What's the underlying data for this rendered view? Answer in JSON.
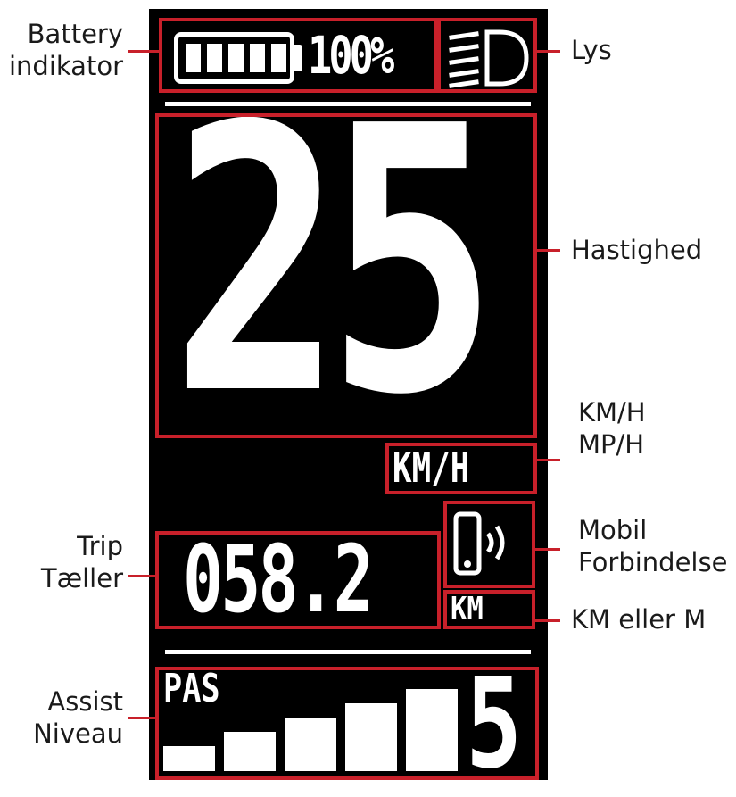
{
  "display": {
    "battery_percent": "100%",
    "battery_level": 1.0,
    "speed": "25",
    "speed_unit": "KM/H",
    "trip": "058.2",
    "trip_unit": "KM",
    "pas_label": "PAS",
    "assist_level": "5",
    "assist_level_value": 5,
    "assist_level_max": 5
  },
  "labels": {
    "battery_line1": "Battery",
    "battery_line2": "indikator",
    "lys": "Lys",
    "hastighed": "Hastighed",
    "unit_line1": "KM/H",
    "unit_line2": "MP/H",
    "mobil_line1": "Mobil",
    "mobil_line2": "Forbindelse",
    "km_eller_m": "KM eller M",
    "trip_line1": "Trip",
    "trip_line2": "Tæller",
    "assist_line1": "Assist",
    "assist_line2": "Niveau"
  },
  "colors": {
    "highlight": "#c8202a",
    "display_bg": "#000000",
    "display_fg": "#ffffff"
  },
  "icons": [
    "battery-icon",
    "headlight-icon",
    "phone-bluetooth-icon"
  ]
}
